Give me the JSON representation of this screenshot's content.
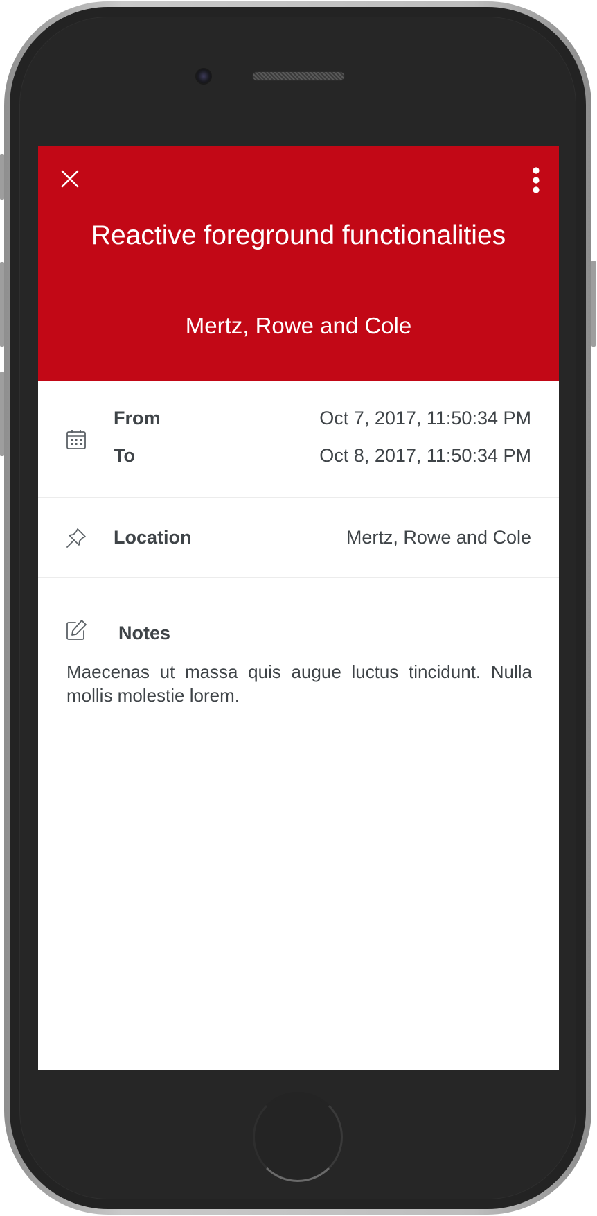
{
  "event": {
    "title": "Reactive foreground functionalities",
    "organizer": "Mertz, Rowe and Cole"
  },
  "header": {
    "close_icon": "close-icon",
    "menu_icon": "more-vertical-icon",
    "accent_color": "#c20816"
  },
  "dates": {
    "icon": "calendar-icon",
    "from_label": "From",
    "from_value": "Oct 7, 2017, 11:50:34 PM",
    "to_label": "To",
    "to_value": "Oct 8, 2017, 11:50:34 PM"
  },
  "location": {
    "icon": "pin-icon",
    "label": "Location",
    "value": "Mertz, Rowe and Cole"
  },
  "notes": {
    "icon": "edit-icon",
    "label": "Notes",
    "text": "Maecenas ut massa quis augue luctus tincidunt. Nulla mollis molestie lorem."
  }
}
